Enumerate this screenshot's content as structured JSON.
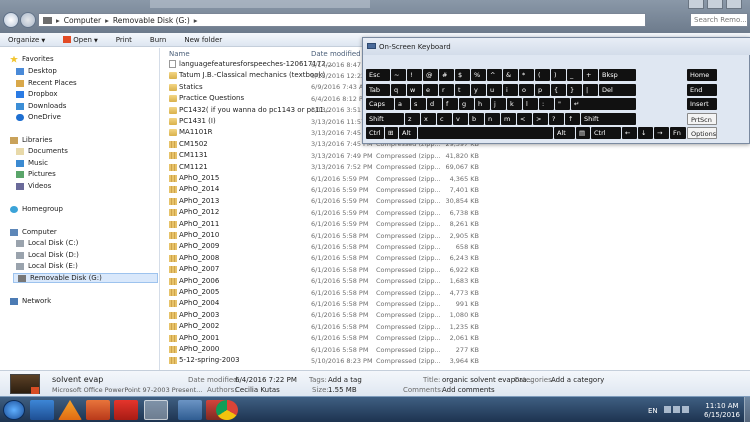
{
  "window": {
    "address": [
      "Computer",
      "Removable Disk (G:)"
    ],
    "search_placeholder": "Search Remo..."
  },
  "toolbar": {
    "organize": "Organize",
    "open": "Open",
    "print": "Print",
    "burn": "Burn",
    "new_folder": "New folder"
  },
  "sidebar": {
    "favorites": "Favorites",
    "favorites_items": [
      "Desktop",
      "Recent Places",
      "Dropbox",
      "Downloads",
      "OneDrive"
    ],
    "libraries": "Libraries",
    "library_items": [
      "Documents",
      "Music",
      "Pictures",
      "Videos"
    ],
    "homegroup": "Homegroup",
    "computer": "Computer",
    "computer_items": [
      "Local Disk (C:)",
      "Local Disk (D:)",
      "Local Disk (E:)",
      "Removable Disk (G:)"
    ],
    "network": "Network"
  },
  "columns": {
    "name": "Name",
    "date": "Date modified"
  },
  "files": [
    {
      "icon": "doc",
      "name": "languagefeaturesforspeeches-120617172...",
      "date": "6/14/2016 8:47 PM",
      "type": "",
      "size": ""
    },
    {
      "icon": "folder",
      "name": "Tatum J.B.-Classical mechanics (textbook)",
      "date": "5/15/2016 12:22 PM",
      "type": "",
      "size": ""
    },
    {
      "icon": "folder",
      "name": "Statics",
      "date": "6/9/2016 7:43 AM",
      "type": "",
      "size": ""
    },
    {
      "icon": "folder",
      "name": "Practice Questions",
      "date": "6/4/2016 8:12 PM",
      "type": "",
      "size": ""
    },
    {
      "icon": "folder",
      "name": "PC1432( if you wanna do pc1143 or pc11...",
      "date": "3/13/2016 3:51 PM",
      "type": "",
      "size": ""
    },
    {
      "icon": "folder",
      "name": "PC1431 (I)",
      "date": "3/13/2016 11:57 AM",
      "type": "",
      "size": ""
    },
    {
      "icon": "folder",
      "name": "MA1101R",
      "date": "3/13/2016 7:45 PM",
      "type": "",
      "size": ""
    },
    {
      "icon": "zip",
      "name": "CM1502",
      "date": "3/13/2016 7:45 PM",
      "type": "Compressed (zipp...",
      "size": "29,397 KB"
    },
    {
      "icon": "zip",
      "name": "CM1131",
      "date": "3/13/2016 7:49 PM",
      "type": "Compressed (zipp...",
      "size": "41,820 KB"
    },
    {
      "icon": "zip",
      "name": "CM1121",
      "date": "3/13/2016 7:52 PM",
      "type": "Compressed (zipp...",
      "size": "69,067 KB"
    },
    {
      "icon": "zip",
      "name": "APhO_2015",
      "date": "6/1/2016 5:59 PM",
      "type": "Compressed (zipp...",
      "size": "4,365 KB"
    },
    {
      "icon": "zip",
      "name": "APhO_2014",
      "date": "6/1/2016 5:59 PM",
      "type": "Compressed (zipp...",
      "size": "7,401 KB"
    },
    {
      "icon": "zip",
      "name": "APhO_2013",
      "date": "6/1/2016 5:59 PM",
      "type": "Compressed (zipp...",
      "size": "30,854 KB"
    },
    {
      "icon": "zip",
      "name": "APhO_2012",
      "date": "6/1/2016 5:59 PM",
      "type": "Compressed (zipp...",
      "size": "6,738 KB"
    },
    {
      "icon": "zip",
      "name": "APhO_2011",
      "date": "6/1/2016 5:59 PM",
      "type": "Compressed (zipp...",
      "size": "8,261 KB"
    },
    {
      "icon": "zip",
      "name": "APhO_2010",
      "date": "6/1/2016 5:58 PM",
      "type": "Compressed (zipp...",
      "size": "2,905 KB"
    },
    {
      "icon": "zip",
      "name": "APhO_2009",
      "date": "6/1/2016 5:58 PM",
      "type": "Compressed (zipp...",
      "size": "658 KB"
    },
    {
      "icon": "zip",
      "name": "APhO_2008",
      "date": "6/1/2016 5:58 PM",
      "type": "Compressed (zipp...",
      "size": "6,243 KB"
    },
    {
      "icon": "zip",
      "name": "APhO_2007",
      "date": "6/1/2016 5:58 PM",
      "type": "Compressed (zipp...",
      "size": "6,922 KB"
    },
    {
      "icon": "zip",
      "name": "APhO_2006",
      "date": "6/1/2016 5:58 PM",
      "type": "Compressed (zipp...",
      "size": "1,683 KB"
    },
    {
      "icon": "zip",
      "name": "APhO_2005",
      "date": "6/1/2016 5:58 PM",
      "type": "Compressed (zipp...",
      "size": "4,773 KB"
    },
    {
      "icon": "zip",
      "name": "APhO_2004",
      "date": "6/1/2016 5:58 PM",
      "type": "Compressed (zipp...",
      "size": "991 KB"
    },
    {
      "icon": "zip",
      "name": "APhO_2003",
      "date": "6/1/2016 5:58 PM",
      "type": "Compressed (zipp...",
      "size": "1,080 KB"
    },
    {
      "icon": "zip",
      "name": "APhO_2002",
      "date": "6/1/2016 5:58 PM",
      "type": "Compressed (zipp...",
      "size": "1,235 KB"
    },
    {
      "icon": "zip",
      "name": "APhO_2001",
      "date": "6/1/2016 5:58 PM",
      "type": "Compressed (zipp...",
      "size": "2,061 KB"
    },
    {
      "icon": "zip",
      "name": "APhO_2000",
      "date": "6/1/2016 5:58 PM",
      "type": "Compressed (zipp...",
      "size": "277 KB"
    },
    {
      "icon": "zip",
      "name": "5-12-spring-2003",
      "date": "5/10/2016 8:23 PM",
      "type": "Compressed (zipp...",
      "size": "3,964 KB"
    }
  ],
  "osk": {
    "title": "On-Screen Keyboard",
    "rows": [
      [
        "Esc",
        "~",
        "!",
        "@",
        "#",
        "$",
        "%",
        "^",
        "&",
        "*",
        "(",
        ")",
        "_",
        "+",
        "Bksp",
        "Home"
      ],
      [
        "Tab",
        "q",
        "w",
        "e",
        "r",
        "t",
        "y",
        "u",
        "i",
        "o",
        "p",
        "{",
        "}",
        "|",
        "Del",
        "End"
      ],
      [
        "Caps",
        "a",
        "s",
        "d",
        "f",
        "g",
        "h",
        "j",
        "k",
        "l",
        ":",
        "\"",
        "↵",
        "Insert"
      ],
      [
        "Shift",
        "z",
        "x",
        "c",
        "v",
        "b",
        "n",
        "m",
        "<",
        ">",
        "?",
        "↑",
        "Shift",
        "PrtScn"
      ],
      [
        "Ctrl",
        "⊞",
        "Alt",
        "",
        "Alt",
        "▤",
        "Ctrl",
        "←",
        "↓",
        "→",
        "Fn",
        "Options"
      ]
    ]
  },
  "details": {
    "filename": "solvent evap",
    "filetype": "Microsoft Office PowerPoint 97-2003 Present...",
    "date_modified_label": "Date modified:",
    "date_modified": "6/4/2016 7:22 PM",
    "authors_label": "Authors:",
    "authors": "Cecilia Kutas",
    "tags_label": "Tags:",
    "tags": "Add a tag",
    "size_label": "Size:",
    "size": "1.55 MB",
    "title_label": "Title:",
    "title": "organic solvent evapora...",
    "categories_label": "Categories:",
    "categories": "Add a category",
    "comments_label": "Comments:",
    "comments": "Add comments"
  },
  "taskbar": {
    "language": "EN",
    "time": "11:10 AM",
    "date": "6/15/2016"
  }
}
